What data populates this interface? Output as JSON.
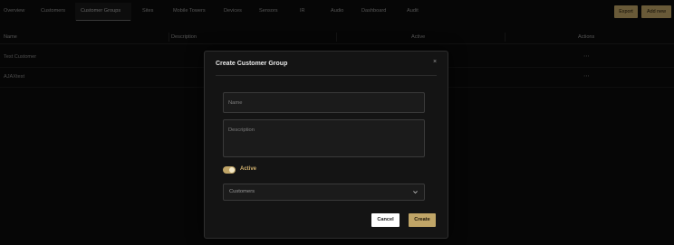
{
  "nav": {
    "tabs": [
      {
        "label": "Overview"
      },
      {
        "label": "Customers"
      },
      {
        "label": "Customer Groups"
      },
      {
        "label": "Sites"
      },
      {
        "label": "Mobile Towers"
      },
      {
        "label": "Devices"
      },
      {
        "label": "Sensors"
      },
      {
        "label": "IR"
      },
      {
        "label": "Audio"
      },
      {
        "label": "Dashboard"
      },
      {
        "label": "Audit"
      }
    ],
    "active_tab": "Customer Groups",
    "export_label": "Export",
    "add_new_label": "Add new"
  },
  "table": {
    "headers": {
      "name": "Name",
      "description": "Description",
      "active": "Active",
      "actions": "Actions"
    },
    "rows": [
      {
        "name": "Test Customer",
        "actions": "⋯"
      },
      {
        "name": "AJAXtest",
        "actions": "⋯"
      }
    ]
  },
  "modal": {
    "title": "Create Customer Group",
    "close_glyph": "×",
    "name_placeholder": "Name",
    "description_placeholder": "Description",
    "active_label": "Active",
    "active_on": true,
    "select_value": "Customers",
    "cancel_label": "Cancel",
    "create_label": "Create"
  },
  "colors": {
    "accent": "#c0a567",
    "background": "#0b0b0b",
    "modal": "#141414"
  },
  "icons": {
    "close": "close-icon",
    "dropdown": "chevron-down-icon",
    "row_actions": "more-horizontal-icon"
  }
}
